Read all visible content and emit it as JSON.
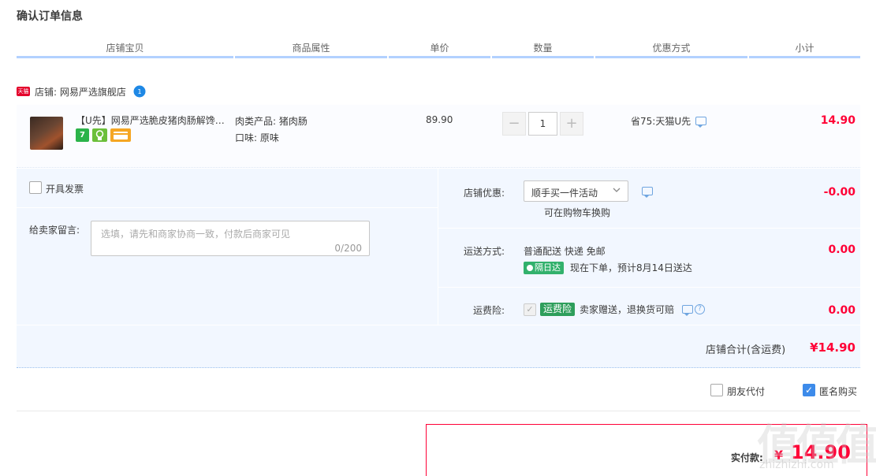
{
  "page": {
    "title": "确认订单信息"
  },
  "columns": [
    "店铺宝贝",
    "商品属性",
    "单价",
    "数量",
    "优惠方式",
    "小计"
  ],
  "shop": {
    "badge": "天猫",
    "label": "店铺: 网易严选旗舰店",
    "ww_count": "1"
  },
  "item": {
    "title": "【U先】网易严选脆皮猪肉肠解馋零食",
    "icon_seven": "7",
    "attr_type": "肉类产品: 猪肉肠",
    "attr_flavor": "口味: 原味",
    "price": "89.90",
    "qty_minus": "−",
    "qty_plus": "+",
    "quantity": "1",
    "promo": "省75:天猫U先",
    "subtotal": "14.90"
  },
  "invoice": {
    "label": "开具发票"
  },
  "message": {
    "label": "给卖家留言:",
    "placeholder": "选填，请先和商家协商一致，付款后商家可见",
    "count": "0/200"
  },
  "shop_discount": {
    "label": "店铺优惠:",
    "selected": "顺手买一件活动",
    "note": "可在购物车换购",
    "amount": "-0.00"
  },
  "shipping": {
    "label": "运送方式:",
    "method": "普通配送 快递 免邮",
    "badge": "隔日达",
    "eta": "现在下单，预计8月14日送达",
    "amount": "0.00"
  },
  "insurance": {
    "label": "运费险:",
    "badge": "运费险",
    "desc": "卖家赠送，退换货可赔",
    "help": "?",
    "amount": "0.00"
  },
  "shop_total": {
    "label": "店铺合计(含运费)",
    "amount": "¥14.90"
  },
  "options": {
    "friend_pay": "朋友代付",
    "anonymous": "匿名购买"
  },
  "payment": {
    "label": "实付款:",
    "currency": "¥",
    "amount": "14.90"
  },
  "watermark": {
    "main": "值值值",
    "sub": "zhizhizhi.com"
  },
  "colors": {
    "accent_red": "#ff0036",
    "panel_bg": "#f2f7ff",
    "header_line": "#b2d1ff",
    "green": "#32b16c",
    "check_blue": "#3d8bea"
  }
}
